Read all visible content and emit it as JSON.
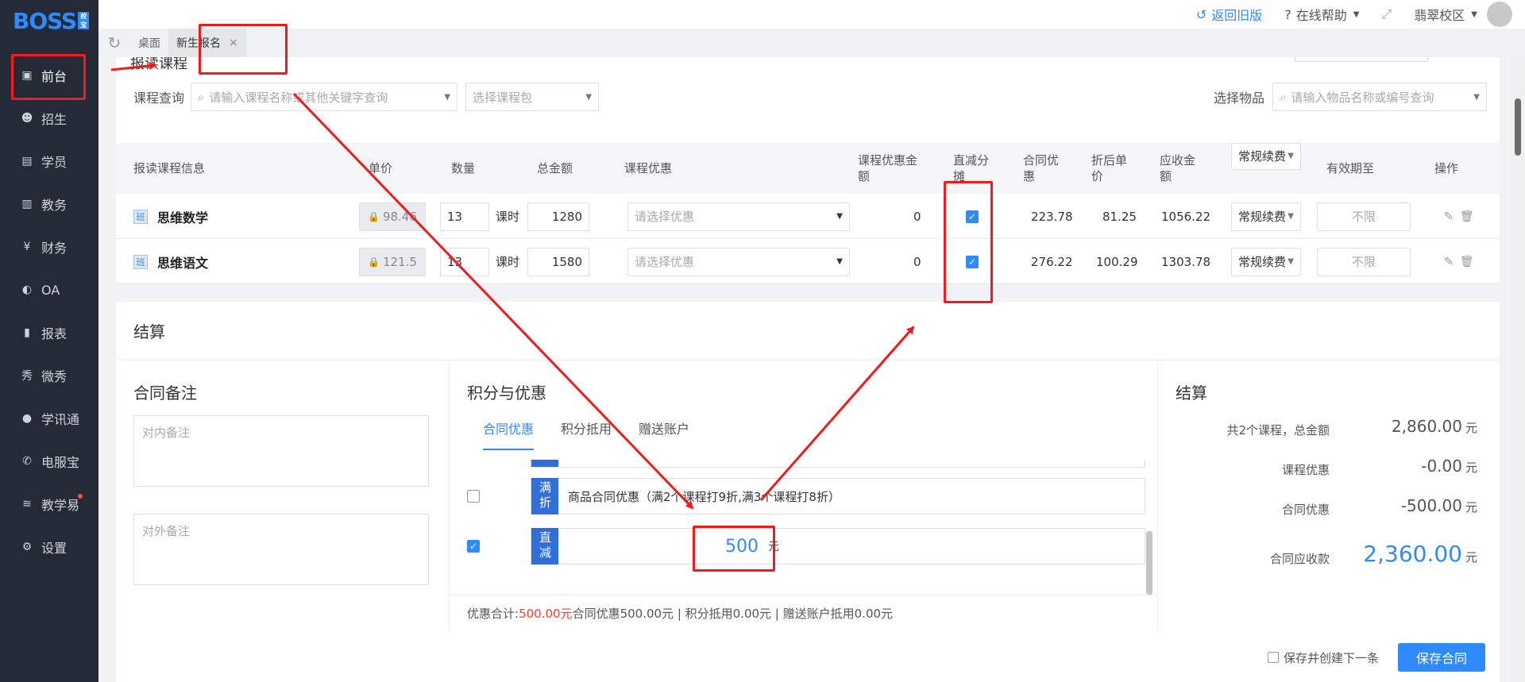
{
  "app": {
    "logo": "BOSS",
    "logo_sub": "校宝"
  },
  "sidebar": {
    "items": [
      {
        "label": "前台",
        "icon": "calendar-icon"
      },
      {
        "label": "招生",
        "icon": "user-add-icon"
      },
      {
        "label": "学员",
        "icon": "id-card-icon"
      },
      {
        "label": "教务",
        "icon": "book-icon"
      },
      {
        "label": "财务",
        "icon": "yen-icon"
      },
      {
        "label": "OA",
        "icon": "oa-icon"
      },
      {
        "label": "报表",
        "icon": "bar-chart-icon"
      },
      {
        "label": "微秀",
        "icon": "xiu-icon"
      },
      {
        "label": "学讯通",
        "icon": "location-icon"
      },
      {
        "label": "电服宝",
        "icon": "phone-icon"
      },
      {
        "label": "教学易",
        "icon": "teach-icon"
      },
      {
        "label": "设置",
        "icon": "gear-icon"
      }
    ]
  },
  "topbar": {
    "back_old": "返回旧版",
    "help": "在线帮助",
    "campus": "翡翠校区"
  },
  "tabs": {
    "desktop": "桌面",
    "new_enroll": "新生报名"
  },
  "course_section": {
    "title": "报读课程",
    "query_label": "课程查询",
    "query_placeholder": "请输入课程名称或其他关键字查询",
    "package_placeholder": "选择课程包",
    "goods_label": "选择物品",
    "goods_placeholder": "请输入物品名称或编号查询"
  },
  "table": {
    "headers": {
      "info": "报读课程信息",
      "price": "单价",
      "qty": "数量",
      "total": "总金额",
      "discount": "课程优惠",
      "discount_amount": "课程优惠金额",
      "direct": "直减分摊",
      "contract": "合同优惠",
      "after_price": "折后单价",
      "receivable": "应收金额",
      "type": "常规续费",
      "valid": "有效期至",
      "ops": "操作"
    },
    "rows": [
      {
        "badge": "班",
        "name": "思维数学",
        "price": "98.46",
        "qty": "13",
        "unit": "课时",
        "total": "1280",
        "discount_ph": "请选择优惠",
        "discount_amount": "0",
        "contract": "223.78",
        "after_price": "81.25",
        "receivable": "1056.22",
        "type": "常规续费",
        "valid": "不限"
      },
      {
        "badge": "班",
        "name": "思维语文",
        "price": "121.5",
        "qty": "13",
        "unit": "课时",
        "total": "1580",
        "discount_ph": "请选择优惠",
        "discount_amount": "0",
        "contract": "276.22",
        "after_price": "100.29",
        "receivable": "1303.78",
        "type": "常规续费",
        "valid": "不限"
      }
    ]
  },
  "settlement": {
    "title": "结算",
    "remarks": {
      "title": "合同备注",
      "internal_ph": "对内备注",
      "external_ph": "对外备注"
    },
    "points": {
      "title": "积分与优惠",
      "tabs": [
        "合同优惠",
        "积分抵用",
        "赠送账户"
      ],
      "offer1": {
        "tag": "满折",
        "text": "商品合同优惠（满2个课程打9折,满3个课程打8折）",
        "checked": false
      },
      "offer2": {
        "tag": "直减",
        "value": "500",
        "unit": "元",
        "checked": true
      },
      "summary_prefix": "优惠合计:",
      "summary_amount": "500.00元",
      "summary_rest": " 合同优惠500.00元 | 积分抵用0.00元 | 赠送账户抵用0.00元"
    },
    "result": {
      "title": "结算",
      "total_label": "共2个课程，总金额",
      "total_value": "2,860.00",
      "course_disc_label": "课程优惠",
      "course_disc_value": "-0.00",
      "contract_disc_label": "合同优惠",
      "contract_disc_value": "-500.00",
      "receivable_label": "合同应收款",
      "receivable_value": "2,360.00",
      "unit": "元"
    }
  },
  "footer": {
    "save_and_new": "保存并创建下一条",
    "save": "保存合同"
  },
  "colors": {
    "accent": "#2e8bff",
    "sidebar_bg": "#252b36",
    "annotation": "#f21b1b",
    "negative": "#ff3b30"
  }
}
